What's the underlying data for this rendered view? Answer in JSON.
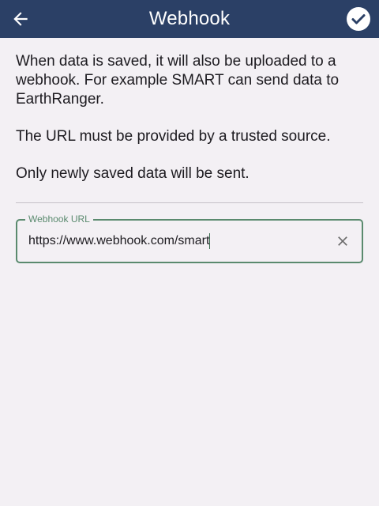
{
  "header": {
    "title": "Webhook",
    "back_icon": "arrow-left-icon",
    "confirm_icon": "check-circle-icon"
  },
  "description": {
    "paragraph1": "When data is saved, it will also be uploaded to a webhook. For example SMART can send data to EarthRanger.",
    "paragraph2": "The URL must be provided by a trusted source.",
    "paragraph3": "Only newly saved data will be sent."
  },
  "webhook_field": {
    "label": "Webhook URL",
    "value": "https://www.webhook.com/smart",
    "clear_icon": "close-icon"
  },
  "colors": {
    "header_bg": "#2b4066",
    "background": "#f3f0f4",
    "field_accent": "#5a8a6e",
    "text": "#1d1b20"
  }
}
